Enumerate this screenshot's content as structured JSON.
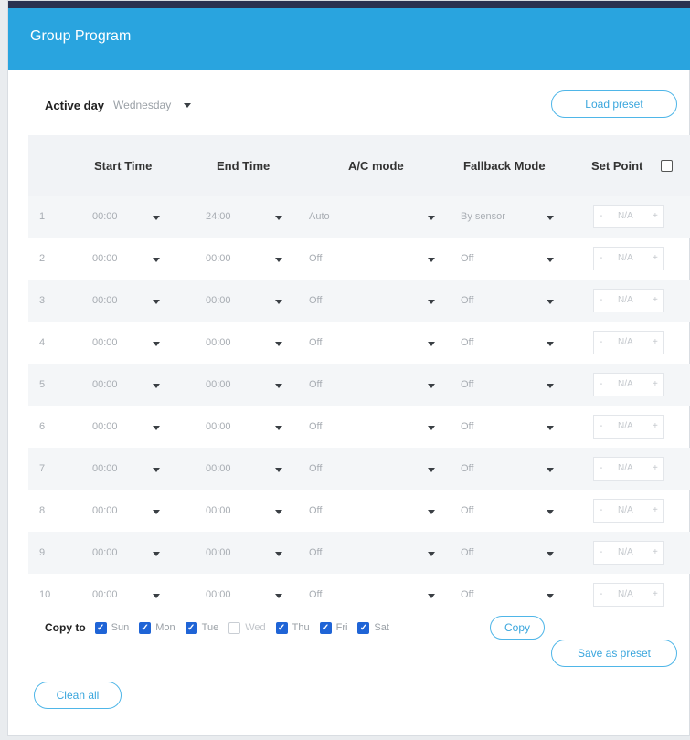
{
  "header": {
    "title": "Group Program"
  },
  "active_day": {
    "label": "Active day",
    "value": "Wednesday"
  },
  "buttons": {
    "load_preset": "Load preset",
    "copy": "Copy",
    "save_preset": "Save as preset",
    "clean_all": "Clean all"
  },
  "columns": {
    "start": "Start Time",
    "end": "End Time",
    "ac": "A/C mode",
    "fallback": "Fallback Mode",
    "setpoint": "Set Point"
  },
  "setpoint_header_checked": false,
  "rows": [
    {
      "n": "1",
      "start": "00:00",
      "end": "24:00",
      "ac": "Auto",
      "fb": "By sensor",
      "sp": "N/A"
    },
    {
      "n": "2",
      "start": "00:00",
      "end": "00:00",
      "ac": "Off",
      "fb": "Off",
      "sp": "N/A"
    },
    {
      "n": "3",
      "start": "00:00",
      "end": "00:00",
      "ac": "Off",
      "fb": "Off",
      "sp": "N/A"
    },
    {
      "n": "4",
      "start": "00:00",
      "end": "00:00",
      "ac": "Off",
      "fb": "Off",
      "sp": "N/A"
    },
    {
      "n": "5",
      "start": "00:00",
      "end": "00:00",
      "ac": "Off",
      "fb": "Off",
      "sp": "N/A"
    },
    {
      "n": "6",
      "start": "00:00",
      "end": "00:00",
      "ac": "Off",
      "fb": "Off",
      "sp": "N/A"
    },
    {
      "n": "7",
      "start": "00:00",
      "end": "00:00",
      "ac": "Off",
      "fb": "Off",
      "sp": "N/A"
    },
    {
      "n": "8",
      "start": "00:00",
      "end": "00:00",
      "ac": "Off",
      "fb": "Off",
      "sp": "N/A"
    },
    {
      "n": "9",
      "start": "00:00",
      "end": "00:00",
      "ac": "Off",
      "fb": "Off",
      "sp": "N/A"
    },
    {
      "n": "10",
      "start": "00:00",
      "end": "00:00",
      "ac": "Off",
      "fb": "Off",
      "sp": "N/A"
    }
  ],
  "setpoint_minus": "-",
  "setpoint_plus": "+",
  "copy_to": {
    "label": "Copy to",
    "days": [
      {
        "label": "Sun",
        "checked": true
      },
      {
        "label": "Mon",
        "checked": true
      },
      {
        "label": "Tue",
        "checked": true
      },
      {
        "label": "Wed",
        "checked": false
      },
      {
        "label": "Thu",
        "checked": true
      },
      {
        "label": "Fri",
        "checked": true
      },
      {
        "label": "Sat",
        "checked": true
      }
    ]
  },
  "colors": {
    "header": "#29a4df",
    "accent": "#3aa6dd",
    "checkbox": "#1f64d6"
  }
}
